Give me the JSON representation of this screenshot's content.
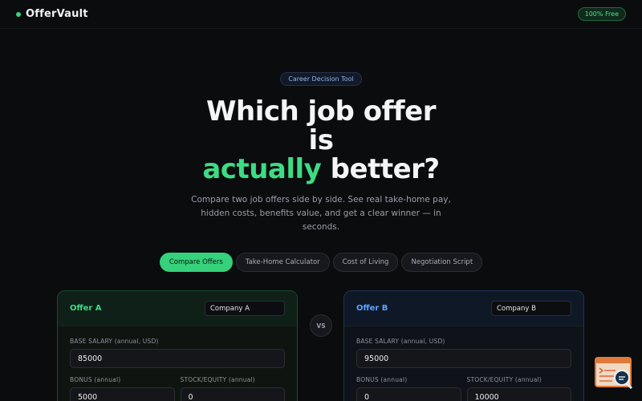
{
  "brand": {
    "name": "OfferVault",
    "badge": "100% Free"
  },
  "hero": {
    "pill": "Career Decision Tool",
    "line1": "Which job offer",
    "line2": "is",
    "accent": "actually",
    "line3_rest": " better?",
    "subtitle": "Compare two job offers side by side. See real take-home pay, hidden costs, benefits value, and get a clear winner — in seconds."
  },
  "tabs": [
    {
      "label": "Compare Offers",
      "active": true
    },
    {
      "label": "Take-Home Calculator",
      "active": false
    },
    {
      "label": "Cost of Living",
      "active": false
    },
    {
      "label": "Negotiation Script",
      "active": false
    }
  ],
  "vs_label": "VS",
  "offer_a": {
    "title": "Offer A",
    "company": "Company A",
    "base_salary_label": "BASE SALARY (annual, USD)",
    "base_salary": "85000",
    "bonus_label": "BONUS (annual)",
    "bonus": "5000",
    "stock_label": "STOCK/EQUITY (annual)",
    "stock": "0"
  },
  "offer_b": {
    "title": "Offer B",
    "company": "Company B",
    "base_salary_label": "BASE SALARY (annual, USD)",
    "base_salary": "95000",
    "bonus_label": "BONUS (annual)",
    "bonus": "0",
    "stock_label": "STOCK/EQUITY (annual)",
    "stock": "10000"
  },
  "colors": {
    "accent_green": "#3ddc84",
    "accent_blue": "#5ba3ff",
    "background": "#0b0c0e"
  },
  "icons": {
    "helper": "search-document-icon"
  }
}
